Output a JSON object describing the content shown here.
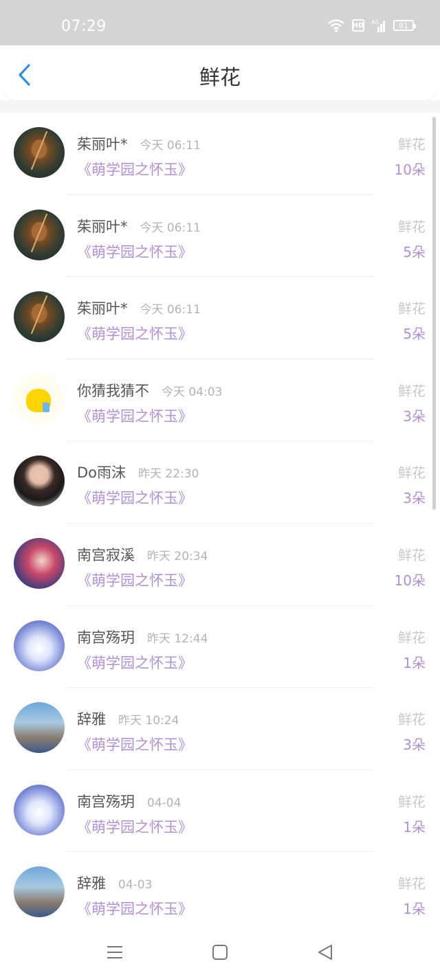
{
  "status_bar": {
    "time": "07:29",
    "hd": "HD",
    "network": "4G",
    "battery": "91",
    "icons": [
      "wifi-icon",
      "hd-badge",
      "signal-icon",
      "battery-icon"
    ]
  },
  "header": {
    "title": "鲜花",
    "back_icon": "chevron-left-icon",
    "accent_color": "#2b8fe6"
  },
  "theme": {
    "link_color": "#b28fd4",
    "name_color": "#555555",
    "muted_color": "#b3b3b3"
  },
  "list": {
    "items": [
      {
        "name": "茱丽叶*",
        "time": "今天 06:11",
        "book": "《萌学园之怀玉》",
        "type": "鲜花",
        "count": "10朵",
        "avatar": "monkey-king-avatar"
      },
      {
        "name": "茱丽叶*",
        "time": "今天 06:11",
        "book": "《萌学园之怀玉》",
        "type": "鲜花",
        "count": "5朵",
        "avatar": "monkey-king-avatar"
      },
      {
        "name": "茱丽叶*",
        "time": "今天 06:11",
        "book": "《萌学园之怀玉》",
        "type": "鲜花",
        "count": "5朵",
        "avatar": "monkey-king-avatar"
      },
      {
        "name": "你猜我猜不",
        "time": "今天 04:03",
        "book": "《萌学园之怀玉》",
        "type": "鲜花",
        "count": "3朵",
        "avatar": "pikachu-avatar"
      },
      {
        "name": "Do雨沫",
        "time": "昨天 22:30",
        "book": "《萌学园之怀玉》",
        "type": "鲜花",
        "count": "3朵",
        "avatar": "boy-portrait-avatar"
      },
      {
        "name": "南宫寂溪",
        "time": "昨天 20:34",
        "book": "《萌学园之怀玉》",
        "type": "鲜花",
        "count": "10朵",
        "avatar": "anime-girl-avatar"
      },
      {
        "name": "南宫殇玥",
        "time": "昨天 12:44",
        "book": "《萌学园之怀玉》",
        "type": "鲜花",
        "count": "1朵",
        "avatar": "white-angel-avatar"
      },
      {
        "name": "辞雅",
        "time": "昨天 10:24",
        "book": "《萌学园之怀玉》",
        "type": "鲜花",
        "count": "3朵",
        "avatar": "girl-seaside-avatar"
      },
      {
        "name": "南宫殇玥",
        "time": "04-04",
        "book": "《萌学园之怀玉》",
        "type": "鲜花",
        "count": "1朵",
        "avatar": "white-angel-avatar"
      },
      {
        "name": "辞雅",
        "time": "04-03",
        "book": "《萌学园之怀玉》",
        "type": "鲜花",
        "count": "1朵",
        "avatar": "girl-seaside-avatar"
      }
    ]
  },
  "nav_bar": {
    "buttons": [
      "menu-icon",
      "home-square-icon",
      "back-triangle-icon"
    ]
  }
}
